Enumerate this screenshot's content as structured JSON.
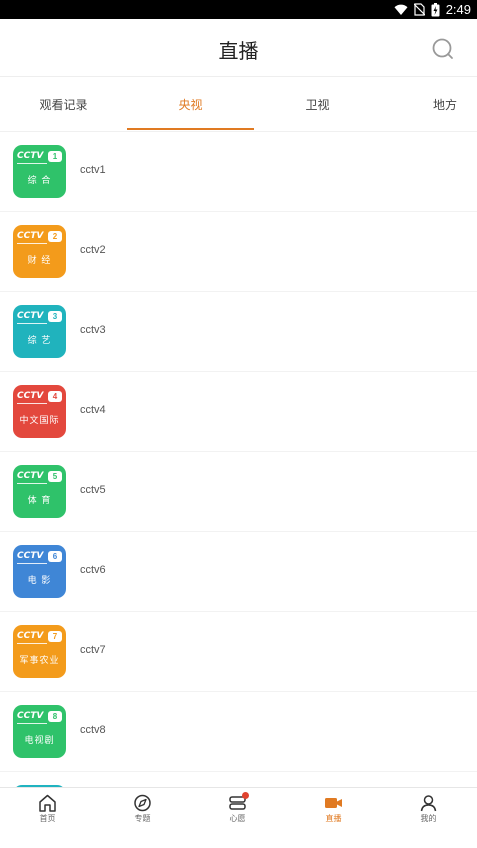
{
  "status": {
    "time": "2:49"
  },
  "header": {
    "title": "直播"
  },
  "tabs": [
    {
      "label": "观看记录"
    },
    {
      "label": "央视"
    },
    {
      "label": "卫视"
    },
    {
      "label": "地方"
    }
  ],
  "active_tab": "央视",
  "channels": [
    {
      "name": "cctv1",
      "logo_number": "1",
      "logo_text": "综 合",
      "color": "#2fc26a"
    },
    {
      "name": "cctv2",
      "logo_number": "2",
      "logo_text": "财 经",
      "color": "#f39b1b"
    },
    {
      "name": "cctv3",
      "logo_number": "3",
      "logo_text": "综 艺",
      "color": "#20b3bd"
    },
    {
      "name": "cctv4",
      "logo_number": "4",
      "logo_text": "中文国际",
      "color": "#e3483d"
    },
    {
      "name": "cctv5",
      "logo_number": "5",
      "logo_text": "体 育",
      "color": "#2fc26a"
    },
    {
      "name": "cctv6",
      "logo_number": "6",
      "logo_text": "电 影",
      "color": "#3f86d6"
    },
    {
      "name": "cctv7",
      "logo_number": "7",
      "logo_text": "军事农业",
      "color": "#f39b1b"
    },
    {
      "name": "cctv8",
      "logo_number": "8",
      "logo_text": "电视剧",
      "color": "#2fc26a"
    }
  ],
  "bottom_nav": [
    {
      "label": "首页",
      "icon": "home-icon"
    },
    {
      "label": "专题",
      "icon": "compass-icon"
    },
    {
      "label": "心愿",
      "icon": "wish-icon"
    },
    {
      "label": "直播",
      "icon": "live-camera-icon"
    },
    {
      "label": "我的",
      "icon": "user-icon"
    }
  ],
  "colors": {
    "accent": "#e07a22",
    "badge": "#e0432f"
  }
}
